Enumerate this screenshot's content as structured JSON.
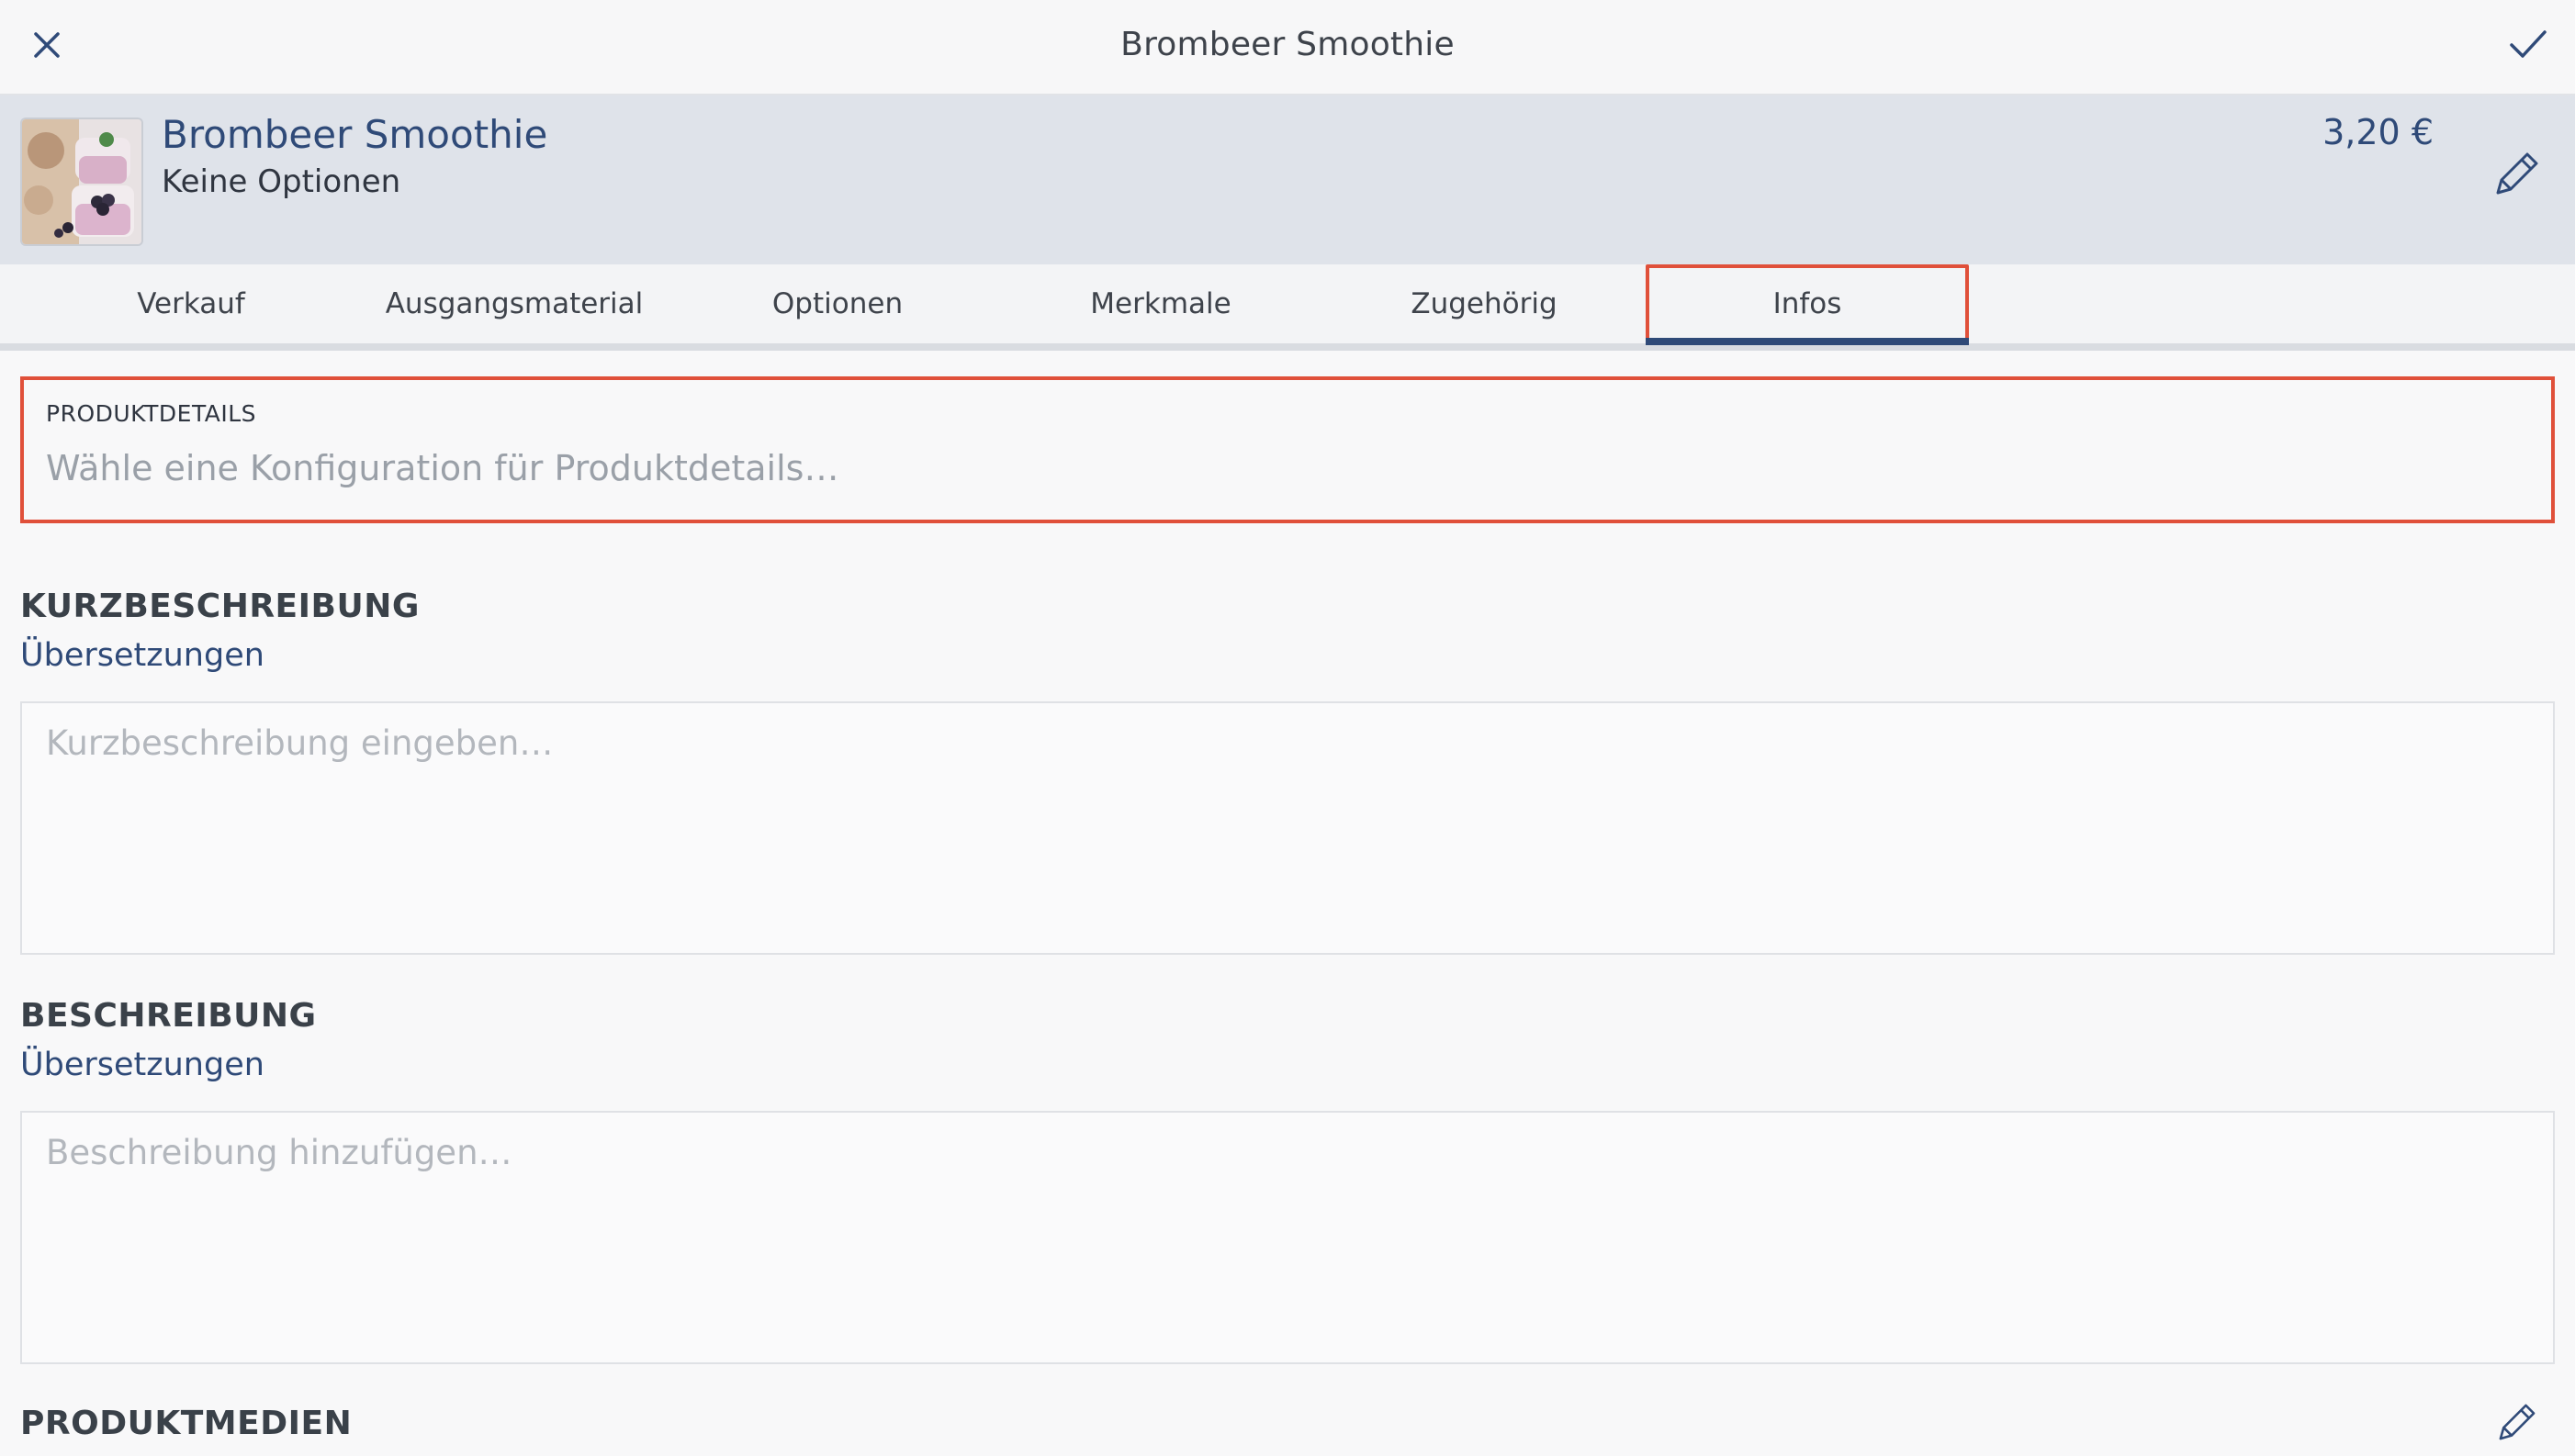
{
  "window": {
    "title": "Brombeer Smoothie"
  },
  "icons": {
    "close": "close-icon",
    "confirm": "checkmark-icon",
    "edit": "pencil-icon"
  },
  "product": {
    "name": "Brombeer Smoothie",
    "subtitle": "Keine Optionen",
    "price": "3,20 €"
  },
  "tabs": [
    {
      "label": "Verkauf"
    },
    {
      "label": "Ausgangsmaterial"
    },
    {
      "label": "Optionen"
    },
    {
      "label": "Merkmale"
    },
    {
      "label": "Zugehörig"
    },
    {
      "label": "Infos",
      "active": true
    }
  ],
  "produktdetails": {
    "label": "PRODUKTDETAILS",
    "placeholder": "Wähle eine Konfiguration für Produktdetails…"
  },
  "kurzbeschreibung": {
    "heading": "KURZBESCHREIBUNG",
    "link": "Übersetzungen",
    "placeholder": "Kurzbeschreibung eingeben…"
  },
  "beschreibung": {
    "heading": "BESCHREIBUNG",
    "link": "Übersetzungen",
    "placeholder": "Beschreibung hinzufügen…"
  },
  "produktmedien": {
    "heading": "PRODUKTMEDIEN"
  },
  "colors": {
    "accent": "#2f4a78",
    "highlight": "#e0503a",
    "header_bg": "#dfe3ea"
  }
}
